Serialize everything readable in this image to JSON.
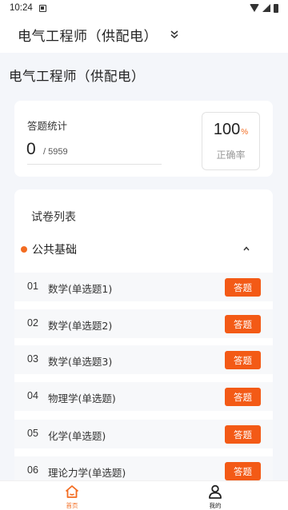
{
  "status_bar": {
    "time": "10:24"
  },
  "header": {
    "subject": "电气工程师（供配电）"
  },
  "page_title": "电气工程师（供配电）",
  "stats": {
    "label": "答题统计",
    "done": "0",
    "total": "/ 5959",
    "accuracy_value": "100",
    "accuracy_unit": "%",
    "accuracy_label": "正确率"
  },
  "paper_list": {
    "title": "试卷列表",
    "category": "公共基础",
    "action_label": "答题",
    "items": [
      {
        "num": "01",
        "name": "数学(单选题1)"
      },
      {
        "num": "02",
        "name": "数学(单选题2)"
      },
      {
        "num": "03",
        "name": "数学(单选题3)"
      },
      {
        "num": "04",
        "name": "物理学(单选题)"
      },
      {
        "num": "05",
        "name": "化学(单选题)"
      },
      {
        "num": "06",
        "name": "理论力学(单选题)"
      }
    ]
  },
  "tabbar": {
    "home_label": "首页",
    "mine_label": "我的",
    "active": "home"
  },
  "colors": {
    "accent": "#f36c21",
    "button": "#f35a16",
    "background": "#f4f6fa"
  },
  "icons": {
    "status": [
      "notification-icon",
      "wifi-icon",
      "signal-icon",
      "battery-icon"
    ],
    "dropdown": "chevron-down-double-icon",
    "collapse": "chevron-up-icon",
    "home": "home-icon",
    "mine": "user-icon"
  }
}
